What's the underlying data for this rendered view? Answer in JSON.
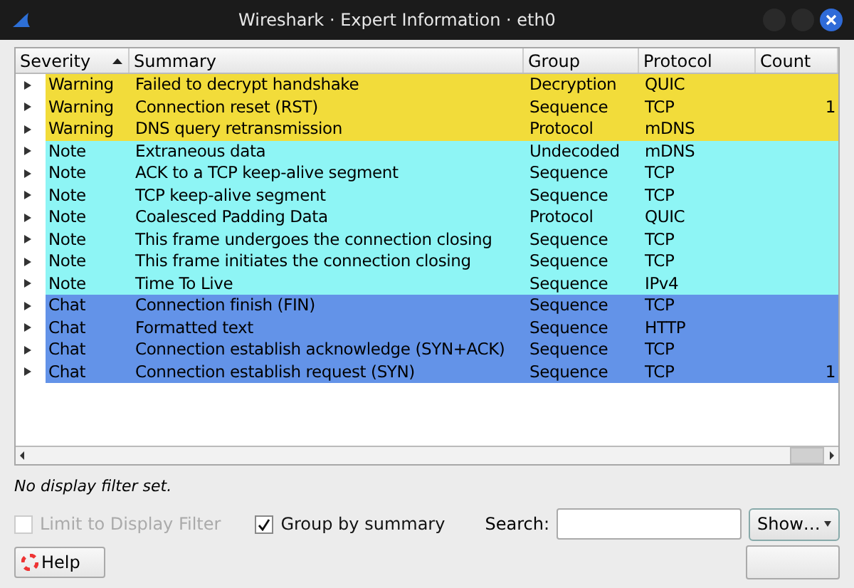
{
  "window": {
    "title": "Wireshark · Expert Information · eth0"
  },
  "table": {
    "columns": [
      {
        "label": "Severity",
        "sorted": true
      },
      {
        "label": "Summary",
        "sorted": false
      },
      {
        "label": "Group",
        "sorted": false
      },
      {
        "label": "Protocol",
        "sorted": false
      },
      {
        "label": "Count",
        "sorted": false
      }
    ],
    "rows": [
      {
        "severity": "Warning",
        "summary": "Failed to decrypt handshake",
        "group": "Decryption",
        "protocol": "QUIC",
        "count": "",
        "color": "#f2dc3a"
      },
      {
        "severity": "Warning",
        "summary": "Connection reset (RST)",
        "group": "Sequence",
        "protocol": "TCP",
        "count": "1",
        "color": "#f2dc3a"
      },
      {
        "severity": "Warning",
        "summary": "DNS query retransmission",
        "group": "Protocol",
        "protocol": "mDNS",
        "count": "",
        "color": "#f2dc3a"
      },
      {
        "severity": "Note",
        "summary": "Extraneous data",
        "group": "Undecoded",
        "protocol": "mDNS",
        "count": "",
        "color": "#8ef5f5"
      },
      {
        "severity": "Note",
        "summary": "ACK to a TCP keep-alive segment",
        "group": "Sequence",
        "protocol": "TCP",
        "count": "",
        "color": "#8ef5f5"
      },
      {
        "severity": "Note",
        "summary": "TCP keep-alive segment",
        "group": "Sequence",
        "protocol": "TCP",
        "count": "",
        "color": "#8ef5f5"
      },
      {
        "severity": "Note",
        "summary": "Coalesced Padding Data",
        "group": "Protocol",
        "protocol": "QUIC",
        "count": "",
        "color": "#8ef5f5"
      },
      {
        "severity": "Note",
        "summary": "This frame undergoes the connection closing",
        "group": "Sequence",
        "protocol": "TCP",
        "count": "",
        "color": "#8ef5f5"
      },
      {
        "severity": "Note",
        "summary": "This frame initiates the connection closing",
        "group": "Sequence",
        "protocol": "TCP",
        "count": "",
        "color": "#8ef5f5"
      },
      {
        "severity": "Note",
        "summary": "Time To Live",
        "group": "Sequence",
        "protocol": "IPv4",
        "count": "",
        "color": "#8ef5f5"
      },
      {
        "severity": "Chat",
        "summary": "Connection finish (FIN)",
        "group": "Sequence",
        "protocol": "TCP",
        "count": "",
        "color": "#6393e8"
      },
      {
        "severity": "Chat",
        "summary": "Formatted text",
        "group": "Sequence",
        "protocol": "HTTP",
        "count": "",
        "color": "#6393e8"
      },
      {
        "severity": "Chat",
        "summary": "Connection establish acknowledge (SYN+ACK)",
        "group": "Sequence",
        "protocol": "TCP",
        "count": "",
        "color": "#6393e8"
      },
      {
        "severity": "Chat",
        "summary": "Connection establish request (SYN)",
        "group": "Sequence",
        "protocol": "TCP",
        "count": "1",
        "color": "#6393e8"
      }
    ]
  },
  "status": "No display filter set.",
  "options": [
    {
      "label": "Limit to Display Filter",
      "checked": false,
      "disabled": true
    },
    {
      "label": "Group by summary",
      "checked": true,
      "disabled": false
    }
  ],
  "search": {
    "label": "Search:"
  },
  "buttons": {
    "show": "Show…",
    "help": "Help"
  }
}
